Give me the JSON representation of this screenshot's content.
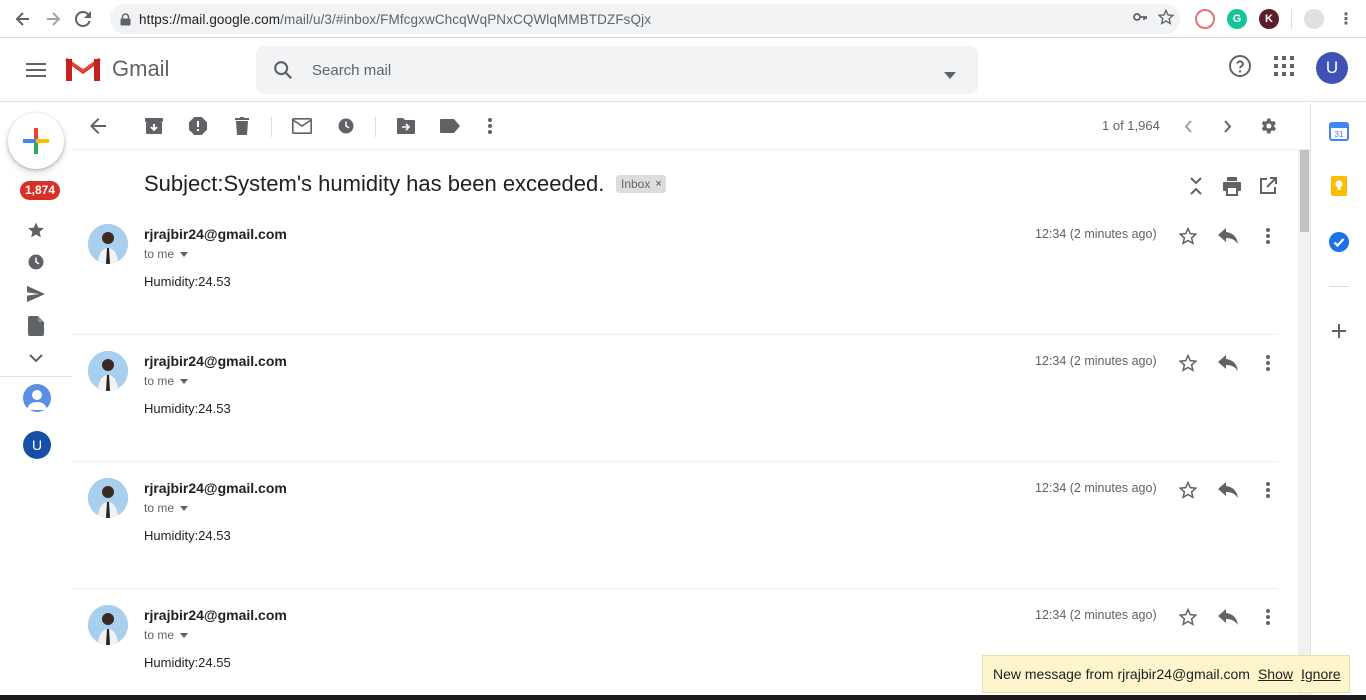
{
  "browser": {
    "url_host": "https://mail.google.com",
    "url_path": "/mail/u/3/#inbox/FMfcgxwChcqWqPNxCQWlqMMBTDZFsQjx",
    "extensions": [
      "",
      "G",
      "K",
      ""
    ]
  },
  "header": {
    "app_name": "Gmail",
    "search_placeholder": "Search mail",
    "avatar_letter": "U"
  },
  "leftrail": {
    "inbox_count": "1,874",
    "account_avatar_letter": "U"
  },
  "toolbar": {
    "pager_text": "1 of 1,964"
  },
  "thread": {
    "subject": "Subject:System's humidity has been exceeded.",
    "label_chip": "Inbox",
    "label_chip_close": "×",
    "messages": [
      {
        "sender": "rjrajbir24@gmail.com",
        "recipient": "to me",
        "time": "12:34 (2 minutes ago)",
        "body": "Humidity:24.53"
      },
      {
        "sender": "rjrajbir24@gmail.com",
        "recipient": "to me",
        "time": "12:34 (2 minutes ago)",
        "body": "Humidity:24.53"
      },
      {
        "sender": "rjrajbir24@gmail.com",
        "recipient": "to me",
        "time": "12:34 (2 minutes ago)",
        "body": "Humidity:24.53"
      },
      {
        "sender": "rjrajbir24@gmail.com",
        "recipient": "to me",
        "time": "12:34 (2 minutes ago)",
        "body": "Humidity:24.55"
      }
    ]
  },
  "notification": {
    "text": "New message from rjrajbir24@gmail.com",
    "show": "Show",
    "ignore": "Ignore"
  },
  "colors": {
    "accent_red": "#d93025",
    "notify_bg": "#fff5cc",
    "avatar_blue": "#3f51b5"
  }
}
